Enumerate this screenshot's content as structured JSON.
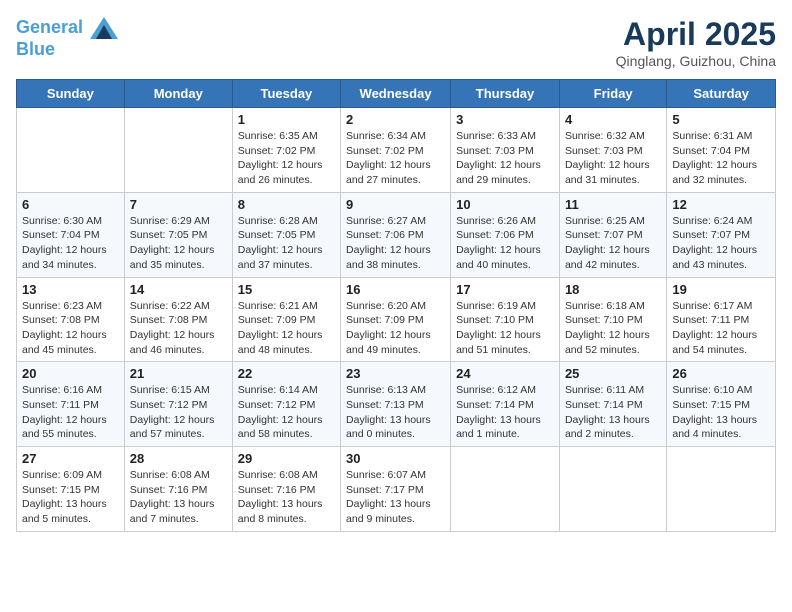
{
  "header": {
    "logo_line1": "General",
    "logo_line2": "Blue",
    "month": "April 2025",
    "location": "Qinglang, Guizhou, China"
  },
  "weekdays": [
    "Sunday",
    "Monday",
    "Tuesday",
    "Wednesday",
    "Thursday",
    "Friday",
    "Saturday"
  ],
  "weeks": [
    [
      {
        "day": "",
        "info": ""
      },
      {
        "day": "",
        "info": ""
      },
      {
        "day": "1",
        "info": "Sunrise: 6:35 AM\nSunset: 7:02 PM\nDaylight: 12 hours and 26 minutes."
      },
      {
        "day": "2",
        "info": "Sunrise: 6:34 AM\nSunset: 7:02 PM\nDaylight: 12 hours and 27 minutes."
      },
      {
        "day": "3",
        "info": "Sunrise: 6:33 AM\nSunset: 7:03 PM\nDaylight: 12 hours and 29 minutes."
      },
      {
        "day": "4",
        "info": "Sunrise: 6:32 AM\nSunset: 7:03 PM\nDaylight: 12 hours and 31 minutes."
      },
      {
        "day": "5",
        "info": "Sunrise: 6:31 AM\nSunset: 7:04 PM\nDaylight: 12 hours and 32 minutes."
      }
    ],
    [
      {
        "day": "6",
        "info": "Sunrise: 6:30 AM\nSunset: 7:04 PM\nDaylight: 12 hours and 34 minutes."
      },
      {
        "day": "7",
        "info": "Sunrise: 6:29 AM\nSunset: 7:05 PM\nDaylight: 12 hours and 35 minutes."
      },
      {
        "day": "8",
        "info": "Sunrise: 6:28 AM\nSunset: 7:05 PM\nDaylight: 12 hours and 37 minutes."
      },
      {
        "day": "9",
        "info": "Sunrise: 6:27 AM\nSunset: 7:06 PM\nDaylight: 12 hours and 38 minutes."
      },
      {
        "day": "10",
        "info": "Sunrise: 6:26 AM\nSunset: 7:06 PM\nDaylight: 12 hours and 40 minutes."
      },
      {
        "day": "11",
        "info": "Sunrise: 6:25 AM\nSunset: 7:07 PM\nDaylight: 12 hours and 42 minutes."
      },
      {
        "day": "12",
        "info": "Sunrise: 6:24 AM\nSunset: 7:07 PM\nDaylight: 12 hours and 43 minutes."
      }
    ],
    [
      {
        "day": "13",
        "info": "Sunrise: 6:23 AM\nSunset: 7:08 PM\nDaylight: 12 hours and 45 minutes."
      },
      {
        "day": "14",
        "info": "Sunrise: 6:22 AM\nSunset: 7:08 PM\nDaylight: 12 hours and 46 minutes."
      },
      {
        "day": "15",
        "info": "Sunrise: 6:21 AM\nSunset: 7:09 PM\nDaylight: 12 hours and 48 minutes."
      },
      {
        "day": "16",
        "info": "Sunrise: 6:20 AM\nSunset: 7:09 PM\nDaylight: 12 hours and 49 minutes."
      },
      {
        "day": "17",
        "info": "Sunrise: 6:19 AM\nSunset: 7:10 PM\nDaylight: 12 hours and 51 minutes."
      },
      {
        "day": "18",
        "info": "Sunrise: 6:18 AM\nSunset: 7:10 PM\nDaylight: 12 hours and 52 minutes."
      },
      {
        "day": "19",
        "info": "Sunrise: 6:17 AM\nSunset: 7:11 PM\nDaylight: 12 hours and 54 minutes."
      }
    ],
    [
      {
        "day": "20",
        "info": "Sunrise: 6:16 AM\nSunset: 7:11 PM\nDaylight: 12 hours and 55 minutes."
      },
      {
        "day": "21",
        "info": "Sunrise: 6:15 AM\nSunset: 7:12 PM\nDaylight: 12 hours and 57 minutes."
      },
      {
        "day": "22",
        "info": "Sunrise: 6:14 AM\nSunset: 7:12 PM\nDaylight: 12 hours and 58 minutes."
      },
      {
        "day": "23",
        "info": "Sunrise: 6:13 AM\nSunset: 7:13 PM\nDaylight: 13 hours and 0 minutes."
      },
      {
        "day": "24",
        "info": "Sunrise: 6:12 AM\nSunset: 7:14 PM\nDaylight: 13 hours and 1 minute."
      },
      {
        "day": "25",
        "info": "Sunrise: 6:11 AM\nSunset: 7:14 PM\nDaylight: 13 hours and 2 minutes."
      },
      {
        "day": "26",
        "info": "Sunrise: 6:10 AM\nSunset: 7:15 PM\nDaylight: 13 hours and 4 minutes."
      }
    ],
    [
      {
        "day": "27",
        "info": "Sunrise: 6:09 AM\nSunset: 7:15 PM\nDaylight: 13 hours and 5 minutes."
      },
      {
        "day": "28",
        "info": "Sunrise: 6:08 AM\nSunset: 7:16 PM\nDaylight: 13 hours and 7 minutes."
      },
      {
        "day": "29",
        "info": "Sunrise: 6:08 AM\nSunset: 7:16 PM\nDaylight: 13 hours and 8 minutes."
      },
      {
        "day": "30",
        "info": "Sunrise: 6:07 AM\nSunset: 7:17 PM\nDaylight: 13 hours and 9 minutes."
      },
      {
        "day": "",
        "info": ""
      },
      {
        "day": "",
        "info": ""
      },
      {
        "day": "",
        "info": ""
      }
    ]
  ]
}
